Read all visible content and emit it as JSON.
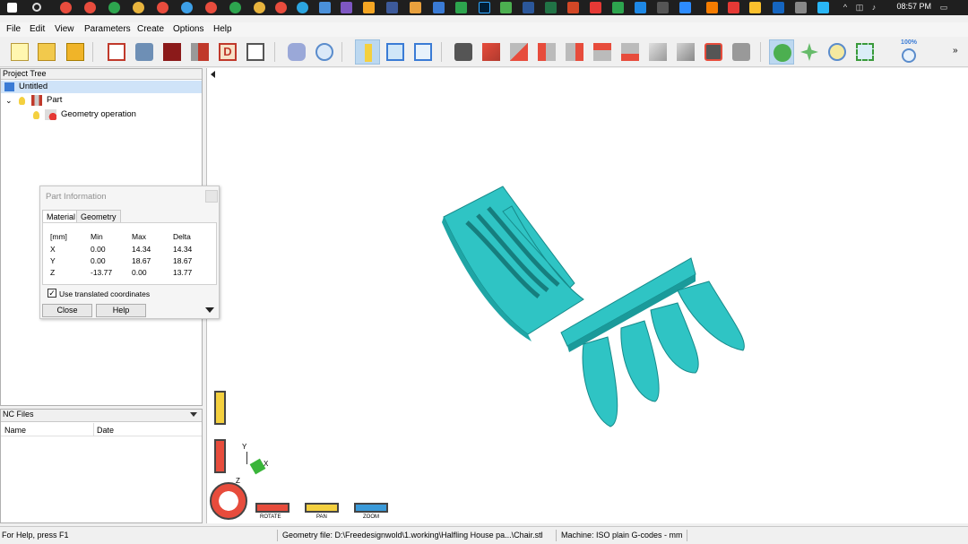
{
  "taskbar": {
    "clock": "08:57 PM",
    "colors": {
      "background": "#1f1f1f"
    }
  },
  "menu": {
    "items": [
      "File",
      "Edit",
      "View",
      "Parameters",
      "Create",
      "Options",
      "Help"
    ]
  },
  "toolbar": {
    "zoom_label": "100%",
    "icons": [
      "new-file-icon",
      "open-file-icon",
      "save-icon",
      "import-icon",
      "part-icon",
      "portrait-icon",
      "tool-icon",
      "d-icon",
      "export-icon",
      "cut-icon",
      "search-icon",
      "info-icon",
      "split-view-icon",
      "window-icon",
      "camera-icon",
      "view-front-icon",
      "view-back-icon",
      "view-left-icon",
      "view-right-icon",
      "view-top-icon",
      "view-bottom-icon",
      "view-iso-icon",
      "view-box-icon",
      "camera-red-icon",
      "camera-gray-icon",
      "rotate-icon",
      "pan-icon",
      "zoom-in-icon",
      "zoom-window-icon",
      "zoom-100-icon"
    ]
  },
  "project_tree": {
    "title": "Project Tree",
    "root": "Untitled",
    "part": "Part",
    "operation": "Geometry operation"
  },
  "nc_files": {
    "title": "NC Files",
    "columns": [
      "Name",
      "Date"
    ]
  },
  "part_info": {
    "title": "Part Information",
    "tabs": [
      "Material",
      "Geometry"
    ],
    "headers": [
      "[mm]",
      "Min",
      "Max",
      "Delta"
    ],
    "rows": [
      [
        "X",
        "0.00",
        "14.34",
        "14.34"
      ],
      [
        "Y",
        "0.00",
        "18.67",
        "18.67"
      ],
      [
        "Z",
        "-13.77",
        "0.00",
        "13.77"
      ]
    ],
    "checkbox_label": "Use translated coordinates",
    "checkbox_checked": true,
    "close_label": "Close",
    "help_label": "Help"
  },
  "viewport": {
    "mode_labels": [
      "ROTATE",
      "PAN",
      "ZOOM"
    ],
    "axes": [
      "Y",
      "X",
      "Z"
    ],
    "model_color": "#2fc4c4"
  },
  "status": {
    "help": "For Help, press F1",
    "geometry": "Geometry file: D:\\Freedesignwold\\1.working\\Halfling House pa...\\Chair.stl",
    "machine": "Machine: ISO plain G-codes - mm"
  }
}
